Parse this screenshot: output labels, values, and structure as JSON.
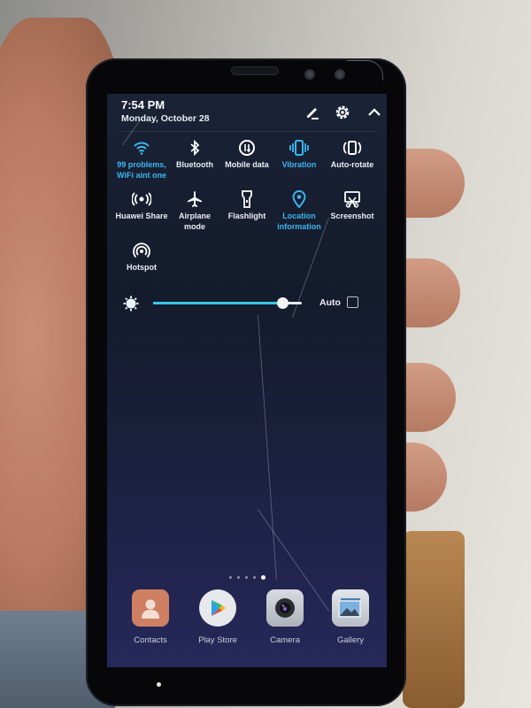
{
  "status_panel": {
    "time": "7:54 PM",
    "date": "Monday, October 28",
    "header_icons": [
      {
        "name": "edit-icon"
      },
      {
        "name": "settings-gear-icon"
      },
      {
        "name": "collapse-chevron-up-icon"
      }
    ]
  },
  "quick_settings": {
    "accent_on": "#3cb6f0",
    "accent_off": "#e9edf3",
    "tiles": [
      {
        "id": "wifi",
        "label_line1": "99 problems,",
        "label_line2": "WiFi aint one",
        "icon": "wifi-icon",
        "active": true
      },
      {
        "id": "bluetooth",
        "label_line1": "Bluetooth",
        "label_line2": "",
        "icon": "bluetooth-icon",
        "active": false
      },
      {
        "id": "mobile-data",
        "label_line1": "Mobile data",
        "label_line2": "",
        "icon": "mobile-data-icon",
        "active": false
      },
      {
        "id": "vibration",
        "label_line1": "Vibration",
        "label_line2": "",
        "icon": "vibration-icon",
        "active": true
      },
      {
        "id": "auto-rotate",
        "label_line1": "Auto-rotate",
        "label_line2": "",
        "icon": "auto-rotate-icon",
        "active": false
      },
      {
        "id": "huawei-share",
        "label_line1": "Huawei Share",
        "label_line2": "",
        "icon": "huawei-share-icon",
        "active": false
      },
      {
        "id": "airplane-mode",
        "label_line1": "Airplane mode",
        "label_line2": "",
        "icon": "airplane-icon",
        "active": false
      },
      {
        "id": "flashlight",
        "label_line1": "Flashlight",
        "label_line2": "",
        "icon": "flashlight-icon",
        "active": false
      },
      {
        "id": "location",
        "label_line1": "Location",
        "label_line2": "information",
        "icon": "location-pin-icon",
        "active": true
      },
      {
        "id": "screenshot",
        "label_line1": "Screenshot",
        "label_line2": "",
        "icon": "screenshot-icon",
        "active": false
      },
      {
        "id": "hotspot",
        "label_line1": "Hotspot",
        "label_line2": "",
        "icon": "hotspot-icon",
        "active": false
      }
    ]
  },
  "brightness": {
    "level_percent": 87,
    "auto_label": "Auto",
    "auto_checked": false,
    "fill_color": "#38c8e6"
  },
  "home": {
    "page_count": 5,
    "active_page": 5,
    "dock": [
      {
        "label": "Contacts",
        "icon": "contacts-icon"
      },
      {
        "label": "Play Store",
        "icon": "play-store-icon"
      },
      {
        "label": "Camera",
        "icon": "camera-icon"
      },
      {
        "label": "Gallery",
        "icon": "gallery-icon"
      }
    ]
  }
}
